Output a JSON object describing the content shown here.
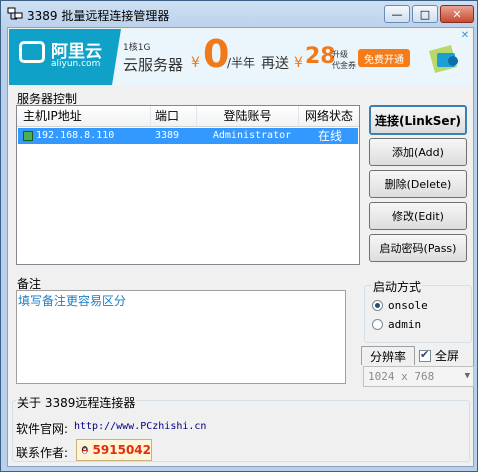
{
  "window": {
    "title": "3389 批量远程连接管理器",
    "minimize_glyph": "—",
    "maximize_glyph": "□",
    "close_glyph": "✕"
  },
  "ad": {
    "brand": "阿里云",
    "brand_domain": "aliyun.com",
    "core_spec": "1核1G",
    "product": "云服务器",
    "yen_sign": "¥",
    "price_zero": "0",
    "per_half_year": "/半年",
    "bonus_text": "再送",
    "bonus_amount": "28",
    "upgrade_line1": "升级",
    "upgrade_line2": "代金券",
    "cta": "免费开通",
    "close_glyph": "✕",
    "colors": {
      "brand_blue": "#10a1c9",
      "price_orange": "#f07a1a",
      "cta_orange": "#f57c18"
    }
  },
  "server_group": {
    "label": "服务器控制",
    "columns": [
      "主机IP地址",
      "端口",
      "登陆账号",
      "网络状态"
    ],
    "rows": [
      {
        "ip": "192.168.8.110",
        "port": "3389",
        "account": "Administrator",
        "status": "在线",
        "selected": true
      }
    ]
  },
  "buttons": {
    "connect": "连接(LinkSer)",
    "add": "添加(Add)",
    "delete": "删除(Delete)",
    "edit": "修改(Edit)",
    "start_password": "启动密码(Pass)"
  },
  "note": {
    "label": "备注",
    "text": "填写备注更容易区分"
  },
  "startup": {
    "label": "启动方式",
    "options": [
      {
        "label": "onsole",
        "selected": true
      },
      {
        "label": "admin",
        "selected": false
      }
    ]
  },
  "resolution": {
    "tab_label": "分辨率",
    "fullscreen_label": "全屏",
    "fullscreen_checked": true,
    "selected": "1024 x 768"
  },
  "about": {
    "label": "关于 3389远程连接器",
    "site_label": "软件官网:",
    "site_url": "http://www.PCzhishi.cn",
    "author_label": "联系作者:",
    "qq_number": "5915042"
  }
}
